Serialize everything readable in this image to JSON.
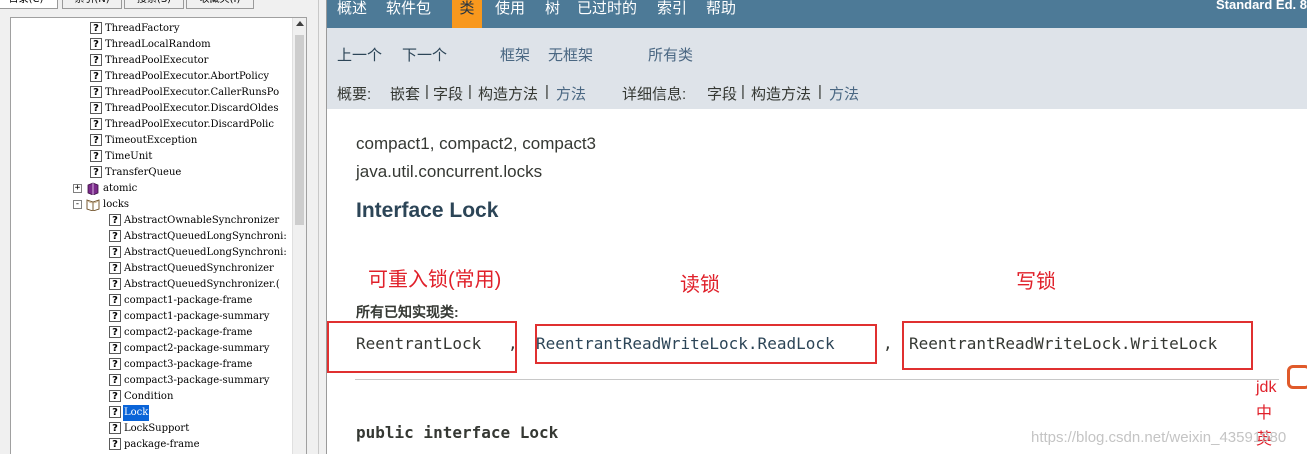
{
  "colors": {
    "topnav_bg": "#4d7a97",
    "active_tab_bg": "#f8981d",
    "subnav_bg": "#dee3e9",
    "annotation_red": "#e0202a",
    "tree_selection": "#0a64d8"
  },
  "left_pane": {
    "tabs": [
      "目录(C)",
      "索引(N)",
      "搜索(S)",
      "收藏夹(I)"
    ],
    "tree": [
      {
        "label": "ThreadFactory",
        "icon": "help-page-icon"
      },
      {
        "label": "ThreadLocalRandom",
        "icon": "help-page-icon"
      },
      {
        "label": "ThreadPoolExecutor",
        "icon": "help-page-icon"
      },
      {
        "label": "ThreadPoolExecutor.AbortPolicy",
        "icon": "help-page-icon"
      },
      {
        "label": "ThreadPoolExecutor.CallerRunsPo",
        "icon": "help-page-icon"
      },
      {
        "label": "ThreadPoolExecutor.DiscardOldes",
        "icon": "help-page-icon"
      },
      {
        "label": "ThreadPoolExecutor.DiscardPolic",
        "icon": "help-page-icon"
      },
      {
        "label": "TimeoutException",
        "icon": "help-page-icon"
      },
      {
        "label": "TimeUnit",
        "icon": "help-page-icon"
      },
      {
        "label": "TransferQueue",
        "icon": "help-page-icon"
      },
      {
        "label": "atomic",
        "icon": "closed-book-icon",
        "expander": "+"
      },
      {
        "label": "locks",
        "icon": "open-book-icon",
        "expander": "-"
      },
      {
        "label": "AbstractOwnableSynchronizer",
        "icon": "help-page-icon"
      },
      {
        "label": "AbstractQueuedLongSynchroni:",
        "icon": "help-page-icon"
      },
      {
        "label": "AbstractQueuedLongSynchroni:",
        "icon": "help-page-icon"
      },
      {
        "label": "AbstractQueuedSynchronizer",
        "icon": "help-page-icon"
      },
      {
        "label": "AbstractQueuedSynchronizer.(",
        "icon": "help-page-icon"
      },
      {
        "label": "compact1-package-frame",
        "icon": "help-page-icon"
      },
      {
        "label": "compact1-package-summary",
        "icon": "help-page-icon"
      },
      {
        "label": "compact2-package-frame",
        "icon": "help-page-icon"
      },
      {
        "label": "compact2-package-summary",
        "icon": "help-page-icon"
      },
      {
        "label": "compact3-package-frame",
        "icon": "help-page-icon"
      },
      {
        "label": "compact3-package-summary",
        "icon": "help-page-icon"
      },
      {
        "label": "Condition",
        "icon": "help-page-icon"
      },
      {
        "label": "Lock",
        "icon": "help-page-icon",
        "selected": true
      },
      {
        "label": "LockSupport",
        "icon": "help-page-icon"
      },
      {
        "label": "package-frame",
        "icon": "help-page-icon"
      }
    ]
  },
  "topnav": {
    "items": [
      "概述",
      "软件包",
      "类",
      "使用",
      "树",
      "已过时的",
      "索引",
      "帮助"
    ],
    "active": "类",
    "edition": "Standard Ed. 8"
  },
  "subnav": {
    "prev": "上一个",
    "next": "下一个",
    "frames": "框架",
    "no_frames": "无框架",
    "all_classes": "所有类",
    "summary_label": "概要:",
    "summary_nested": "嵌套",
    "summary_field": "字段",
    "summary_constr": "构造方法",
    "summary_method": "方法",
    "detail_label": "详细信息:",
    "detail_field": "字段",
    "detail_constr": "构造方法",
    "detail_method": "方法",
    "sep": "|"
  },
  "content": {
    "profiles": "compact1, compact2, compact3",
    "package": "java.util.concurrent.locks",
    "title": "Interface Lock",
    "impl_label": "所有已知实现类:",
    "impl_classes": [
      "ReentrantLock",
      "ReentrantReadWriteLock.ReadLock",
      "ReentrantReadWriteLock.WriteLock"
    ],
    "separator": ",",
    "declaration": "public interface Lock"
  },
  "annotations": {
    "reentrant": "可重入锁(常用)",
    "read": "读锁",
    "write": "写锁",
    "side": [
      "jdk",
      "中",
      "英"
    ]
  },
  "watermark": "https://blog.csdn.net/weixin_43591980"
}
